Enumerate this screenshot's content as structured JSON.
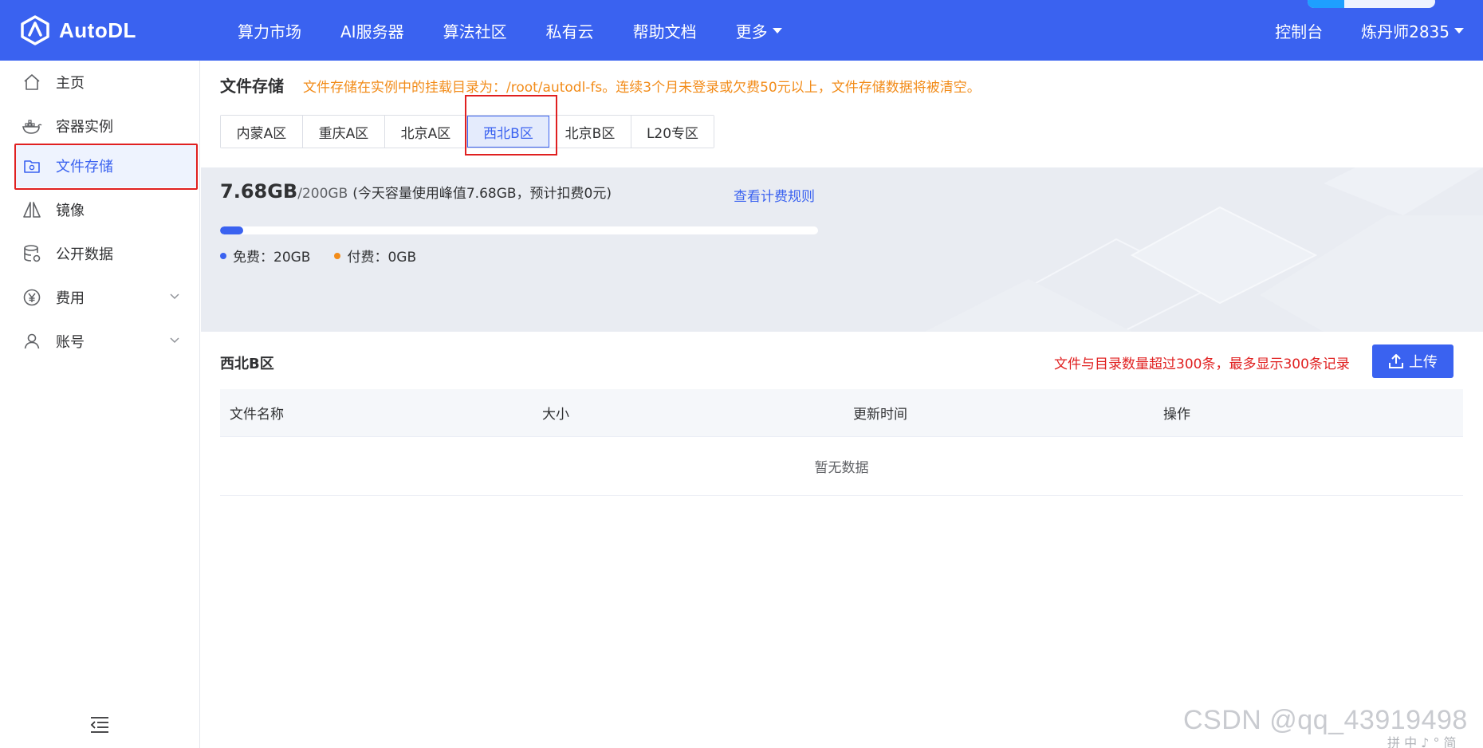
{
  "topbar": {
    "brand": "AutoDL",
    "nav": [
      {
        "label": "算力市场"
      },
      {
        "label": "AI服务器"
      },
      {
        "label": "算法社区"
      },
      {
        "label": "私有云"
      },
      {
        "label": "帮助文档"
      },
      {
        "label": "更多"
      }
    ],
    "console": "控制台",
    "user": "炼丹师2835"
  },
  "sidebar": {
    "items": [
      {
        "label": "主页",
        "icon": "home-icon"
      },
      {
        "label": "容器实例",
        "icon": "docker-icon"
      },
      {
        "label": "文件存储",
        "icon": "folder-gear-icon",
        "active": true
      },
      {
        "label": "镜像",
        "icon": "mirror-icon"
      },
      {
        "label": "公开数据",
        "icon": "database-icon"
      },
      {
        "label": "费用",
        "icon": "yen-icon"
      },
      {
        "label": "账号",
        "icon": "user-icon"
      }
    ]
  },
  "main": {
    "title": "文件存储",
    "notice": "文件存储在实例中的挂载目录为：/root/autodl-fs。连续3个月未登录或欠费50元以上，文件存储数据将被清空。",
    "tabs": [
      {
        "label": "内蒙A区"
      },
      {
        "label": "重庆A区"
      },
      {
        "label": "北京A区"
      },
      {
        "label": "西北B区",
        "selected": true
      },
      {
        "label": "北京B区"
      },
      {
        "label": "L20专区"
      }
    ],
    "usage": {
      "used": "7.68GB",
      "total": "/200GB",
      "note": "(今天容量使用峰值7.68GB，预计扣费0元)",
      "billing_link": "查看计费规则",
      "progress_fraction": 0.0384,
      "free_label": "免费：20GB",
      "paid_label": "付费：0GB",
      "free_color": "#3a62f0",
      "paid_color": "#f28c1a"
    },
    "region_title": "西北B区",
    "limit_note": "文件与目录数量超过300条，最多显示300条记录",
    "upload_label": "上传",
    "table": {
      "columns": [
        "文件名称",
        "大小",
        "更新时间",
        "操作"
      ],
      "empty_text": "暂无数据"
    }
  },
  "footer": {
    "watermark": "CSDN @qq_43919498",
    "ime": "拼 中 ♪ ° 简"
  },
  "colors": {
    "primary": "#3a62f0",
    "warning": "#f28c1a",
    "danger": "#e02020"
  }
}
